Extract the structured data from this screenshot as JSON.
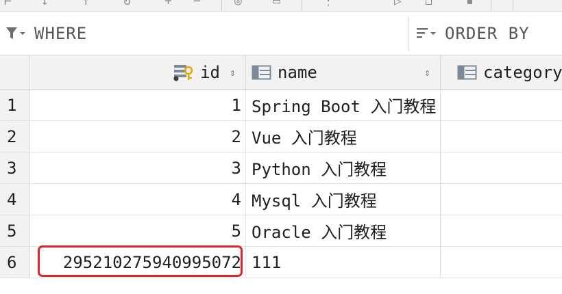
{
  "filter": {
    "where_label": "WHERE",
    "order_label": "ORDER BY"
  },
  "columns": {
    "id": "id",
    "name": "name",
    "category": "category"
  },
  "rows": [
    {
      "num": "1",
      "id": "1",
      "name": "Spring Boot 入门教程",
      "category": ""
    },
    {
      "num": "2",
      "id": "2",
      "name": "Vue 入门教程",
      "category": ""
    },
    {
      "num": "3",
      "id": "3",
      "name": "Python 入门教程",
      "category": ""
    },
    {
      "num": "4",
      "id": "4",
      "name": "Mysql 入门教程",
      "category": ""
    },
    {
      "num": "5",
      "id": "5",
      "name": "Oracle 入门教程",
      "category": ""
    },
    {
      "num": "6",
      "id": "295210275940995072",
      "name": "111",
      "category": ""
    }
  ],
  "icons": {
    "where": "filter-icon",
    "order": "sort-lines-icon",
    "id_column": "primary-key-column-icon",
    "name_column": "column-icon",
    "category_column": "column-icon",
    "sort": "sort-updown-icon"
  },
  "colors": {
    "highlight": "#e0242c",
    "header_bg": "#f2f2f2",
    "key_icon": "#e8a600"
  }
}
